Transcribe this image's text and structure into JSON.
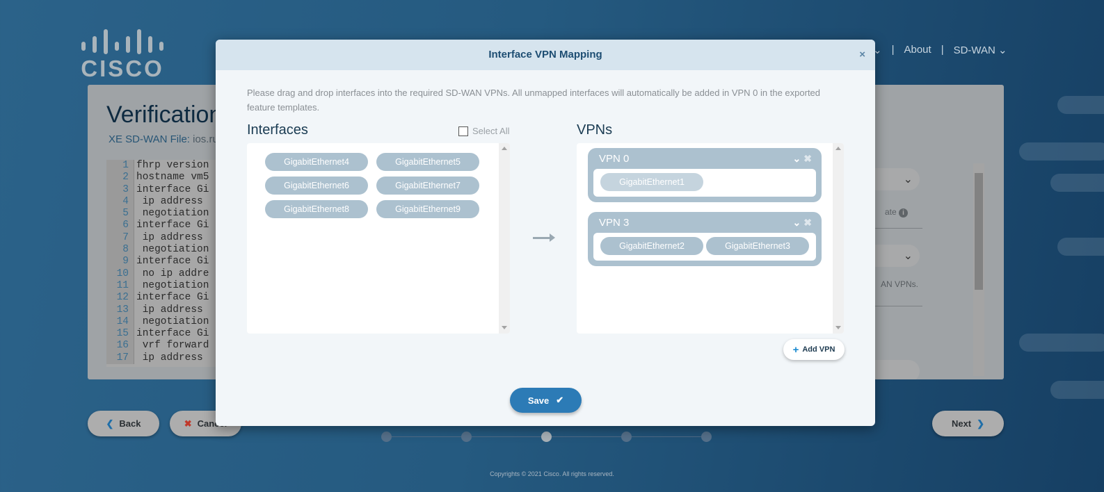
{
  "brand": {
    "logo_text": "cisco"
  },
  "nav": {
    "partial": "⌄",
    "sep": "|",
    "about": "About",
    "sdwan": "SD-WAN ⌄"
  },
  "page": {
    "title": "Verification",
    "file_label": "XE SD-WAN File:",
    "file_value": " ios.ru",
    "code_lines": [
      [
        "1",
        "fhrp version"
      ],
      [
        "2",
        "hostname vm5"
      ],
      [
        "3",
        "interface Gi"
      ],
      [
        "4",
        " ip address"
      ],
      [
        "5",
        " negotiation"
      ],
      [
        "6",
        "interface Gi"
      ],
      [
        "7",
        " ip address"
      ],
      [
        "8",
        " negotiation"
      ],
      [
        "9",
        "interface Gi"
      ],
      [
        "10",
        " no ip addre"
      ],
      [
        "11",
        " negotiation"
      ],
      [
        "12",
        "interface Gi"
      ],
      [
        "13",
        " ip address"
      ],
      [
        "14",
        " negotiation"
      ],
      [
        "15",
        "interface Gi"
      ],
      [
        "16",
        " vrf forward"
      ],
      [
        "17",
        " ip address"
      ]
    ],
    "right_text_1": "ate",
    "right_text_2": "AN VPNs."
  },
  "buttons": {
    "back": "Back",
    "cancel": "Cancel",
    "next": "Next"
  },
  "stepper": {
    "steps": 5,
    "current": 3
  },
  "footer": "Copyrights © 2021 Cisco. All rights reserved.",
  "modal": {
    "title": "Interface VPN Mapping",
    "close": "×",
    "description": "Please drag and drop interfaces into the required SD-WAN VPNs. All unmapped interfaces will automatically be added in VPN 0 in the exported feature templates.",
    "interfaces_heading": "Interfaces",
    "select_all": "Select All",
    "interfaces": [
      "GigabitEthernet4",
      "GigabitEthernet5",
      "GigabitEthernet6",
      "GigabitEthernet7",
      "GigabitEthernet8",
      "GigabitEthernet9"
    ],
    "vpns_heading": "VPNs",
    "vpns": [
      {
        "name": "VPN 0",
        "interfaces": [
          "GigabitEthernet1"
        ]
      },
      {
        "name": "VPN 3",
        "interfaces": [
          "GigabitEthernet2",
          "GigabitEthernet3"
        ]
      }
    ],
    "add_vpn": "Add VPN",
    "save": "Save"
  },
  "colors": {
    "accent": "#2c7bb6",
    "chip": "#acc1cf",
    "header": "#d6e4ee"
  }
}
